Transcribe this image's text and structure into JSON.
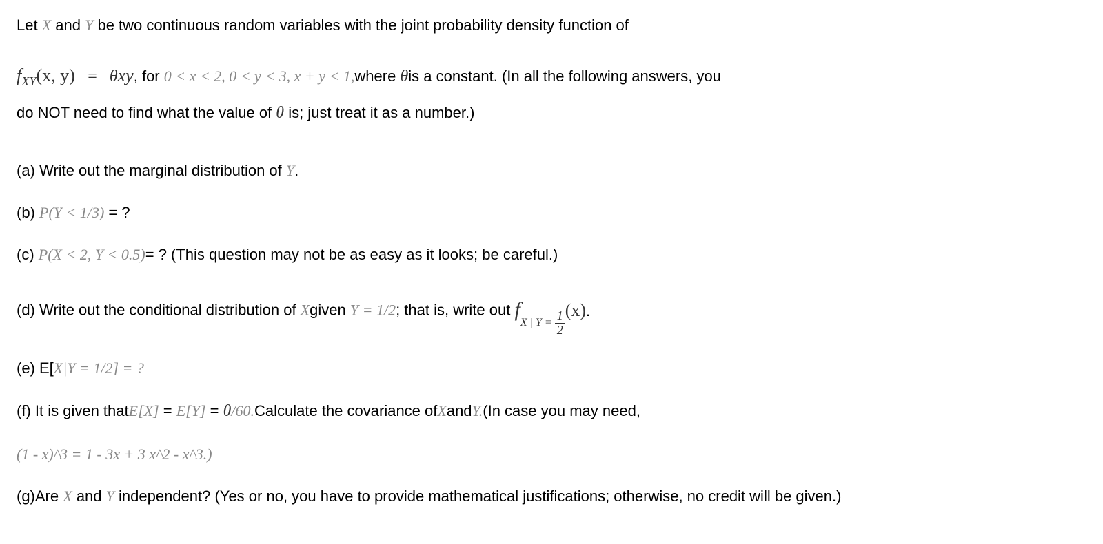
{
  "intro": {
    "part1": "Let ",
    "X": "X",
    "and": " and ",
    "Y": "Y",
    "part2": " be two continuous random variables with the joint probability density function of",
    "fxy": "f",
    "fxy_sub": "XY",
    "fxy_args": "(x, y)",
    "equals": " = ",
    "theta": "θ",
    "xy": "xy",
    "for": ", for ",
    "domain": "0 < x < 2, 0 < y < 3, x + y < 1,",
    "where": "where ",
    "theta2": "θ",
    "constant": "is a constant. (In all the following answers, you",
    "part3": "do NOT need to find what the value of ",
    "theta3": "θ",
    "part4": " is; just treat it as a number.)"
  },
  "a": {
    "label": "(a) Write out the marginal distribution of ",
    "Y": "Y",
    "period": "."
  },
  "b": {
    "label": "(b) ",
    "expr": "P(Y < 1/3)",
    "eq": " = ?"
  },
  "c": {
    "label": "(c) ",
    "expr": "P(X < 2, Y < 0.5)",
    "eq": "= ? (This question may not be as easy as it looks; be careful.)"
  },
  "d": {
    "label": "(d) Write out the conditional distribution of ",
    "X": "X",
    "given": "given ",
    "Yeq": "Y = 1/2",
    "semicolon": "; that is, write out ",
    "f": "f",
    "sub_left": "X | Y = ",
    "frac_num": "1",
    "frac_den": "2",
    "args": "(x)",
    "period": "."
  },
  "e": {
    "label": "(e) E[",
    "expr": "X|Y = 1/2]",
    "eq": " = ?"
  },
  "f": {
    "label": "(f) It is given that",
    "ex": "E[X]",
    "eq1": " = ",
    "ey": "E[Y]",
    "eq2": " = ",
    "theta": "θ",
    "over60": "/60.",
    "rest": "Calculate the covariance of",
    "X": "X",
    "and": "and",
    "Y": "Y.",
    "hint_open": "(In case you may need,",
    "hint": "(1 - x)^3 = 1 - 3x + 3 x^2 - x^3.)"
  },
  "g": {
    "label": "(g)Are ",
    "X": "X",
    "and": " and ",
    "Y": "Y",
    "rest": " independent? (Yes or no, you have to provide mathematical justifications; otherwise, no credit will be given.)"
  }
}
